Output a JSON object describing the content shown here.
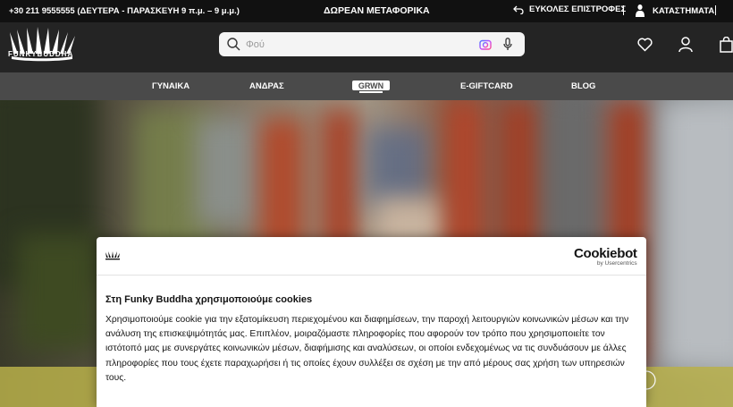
{
  "topbar": {
    "phone": "+30 211 9555555 (ΔΕΥΤΕΡΑ - ΠΑΡΑΣΚΕΥΗ 9 π.μ. – 9 μ.μ.)",
    "shipping": "ΔΩΡΕΑΝ ΜΕΤΑΦΟΡΙΚΑ",
    "returns": "ΕΥΚΟΛΕΣ ΕΠΙΣΤΡΟΦΕΣ",
    "stores": "ΚΑΤΑΣΤΗΜΑΤΑ"
  },
  "header": {
    "logo_text": "FUNKYBUDDHA",
    "search_placeholder": "Φού"
  },
  "nav": {
    "items": [
      "ΓΥΝΑΙΚΑ",
      "ΑΝΔΡΑΣ",
      "E-GIFTCARD",
      "BLOG"
    ],
    "brand_logo": "GRWN"
  },
  "cookie": {
    "provider_name": "Cookiebot",
    "provider_by": "by Usercentrics",
    "title": "Στη Funky Buddha χρησιμοποιούμε cookies",
    "body": "Χρησιμοποιούμε cookie για την εξατομίκευση περιεχομένου και διαφημίσεων, την παροχή λειτουργιών κοινωνικών μέσων και την ανάλυση της επισκεψιμότητάς μας. Επιπλέον, μοιραζόμαστε πληροφορίες που αφορούν τον τρόπο που χρησιμοποιείτε τον ιστότοπό μας με συνεργάτες κοινωνικών μέσων, διαφήμισης και αναλύσεων, οι οποίοι ενδεχομένως να τις συνδυάσουν με άλλες πληροφορίες που τους έχετε παραχωρήσει ή τις οποίες έχουν συλλέξει σε σχέση με την από μέρους σας χρήση των υπηρεσιών τους."
  }
}
